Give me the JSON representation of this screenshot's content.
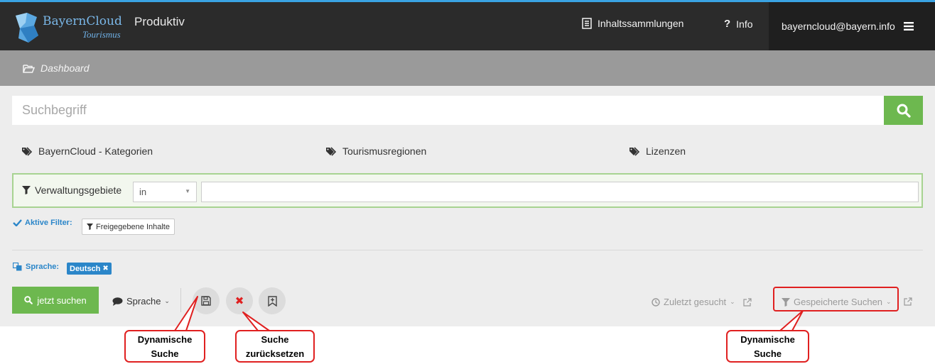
{
  "header": {
    "brand": "BayernCloud",
    "brand_sub": "Tourismus",
    "app_title": "Produktiv",
    "collections_label": "Inhaltssammlungen",
    "info_label": "Info",
    "user_email": "bayerncloud@bayern.info"
  },
  "breadcrumb": {
    "label": "Dashboard"
  },
  "search": {
    "placeholder": "Suchbegriff"
  },
  "categories": [
    {
      "label": "BayernCloud - Kategorien"
    },
    {
      "label": "Tourismusregionen"
    },
    {
      "label": "Lizenzen"
    }
  ],
  "filter": {
    "label": "Verwaltungsgebiete",
    "operator": "in",
    "value": ""
  },
  "active_filters": {
    "label": "Aktive Filter:",
    "chips": [
      {
        "label": "Freigegebene Inhalte"
      }
    ]
  },
  "language": {
    "label": "Sprache:",
    "selected": "Deutsch"
  },
  "toolbar": {
    "search_label": "jetzt suchen",
    "language_menu_label": "Sprache",
    "recent_label": "Zuletzt gesucht",
    "saved_label": "Gespeicherte Suchen"
  },
  "callouts": {
    "save_line1": "Dynamische",
    "save_line2": "Suche",
    "reset_line1": "Suche",
    "reset_line2": "zurücksetzen",
    "saved_line1": "Dynamische",
    "saved_line2": "Suche"
  },
  "colors": {
    "accent_green": "#6db84f",
    "link_blue": "#2b86c9",
    "highlight_red": "#e02020",
    "topbar_dark": "#2b2b2b"
  }
}
